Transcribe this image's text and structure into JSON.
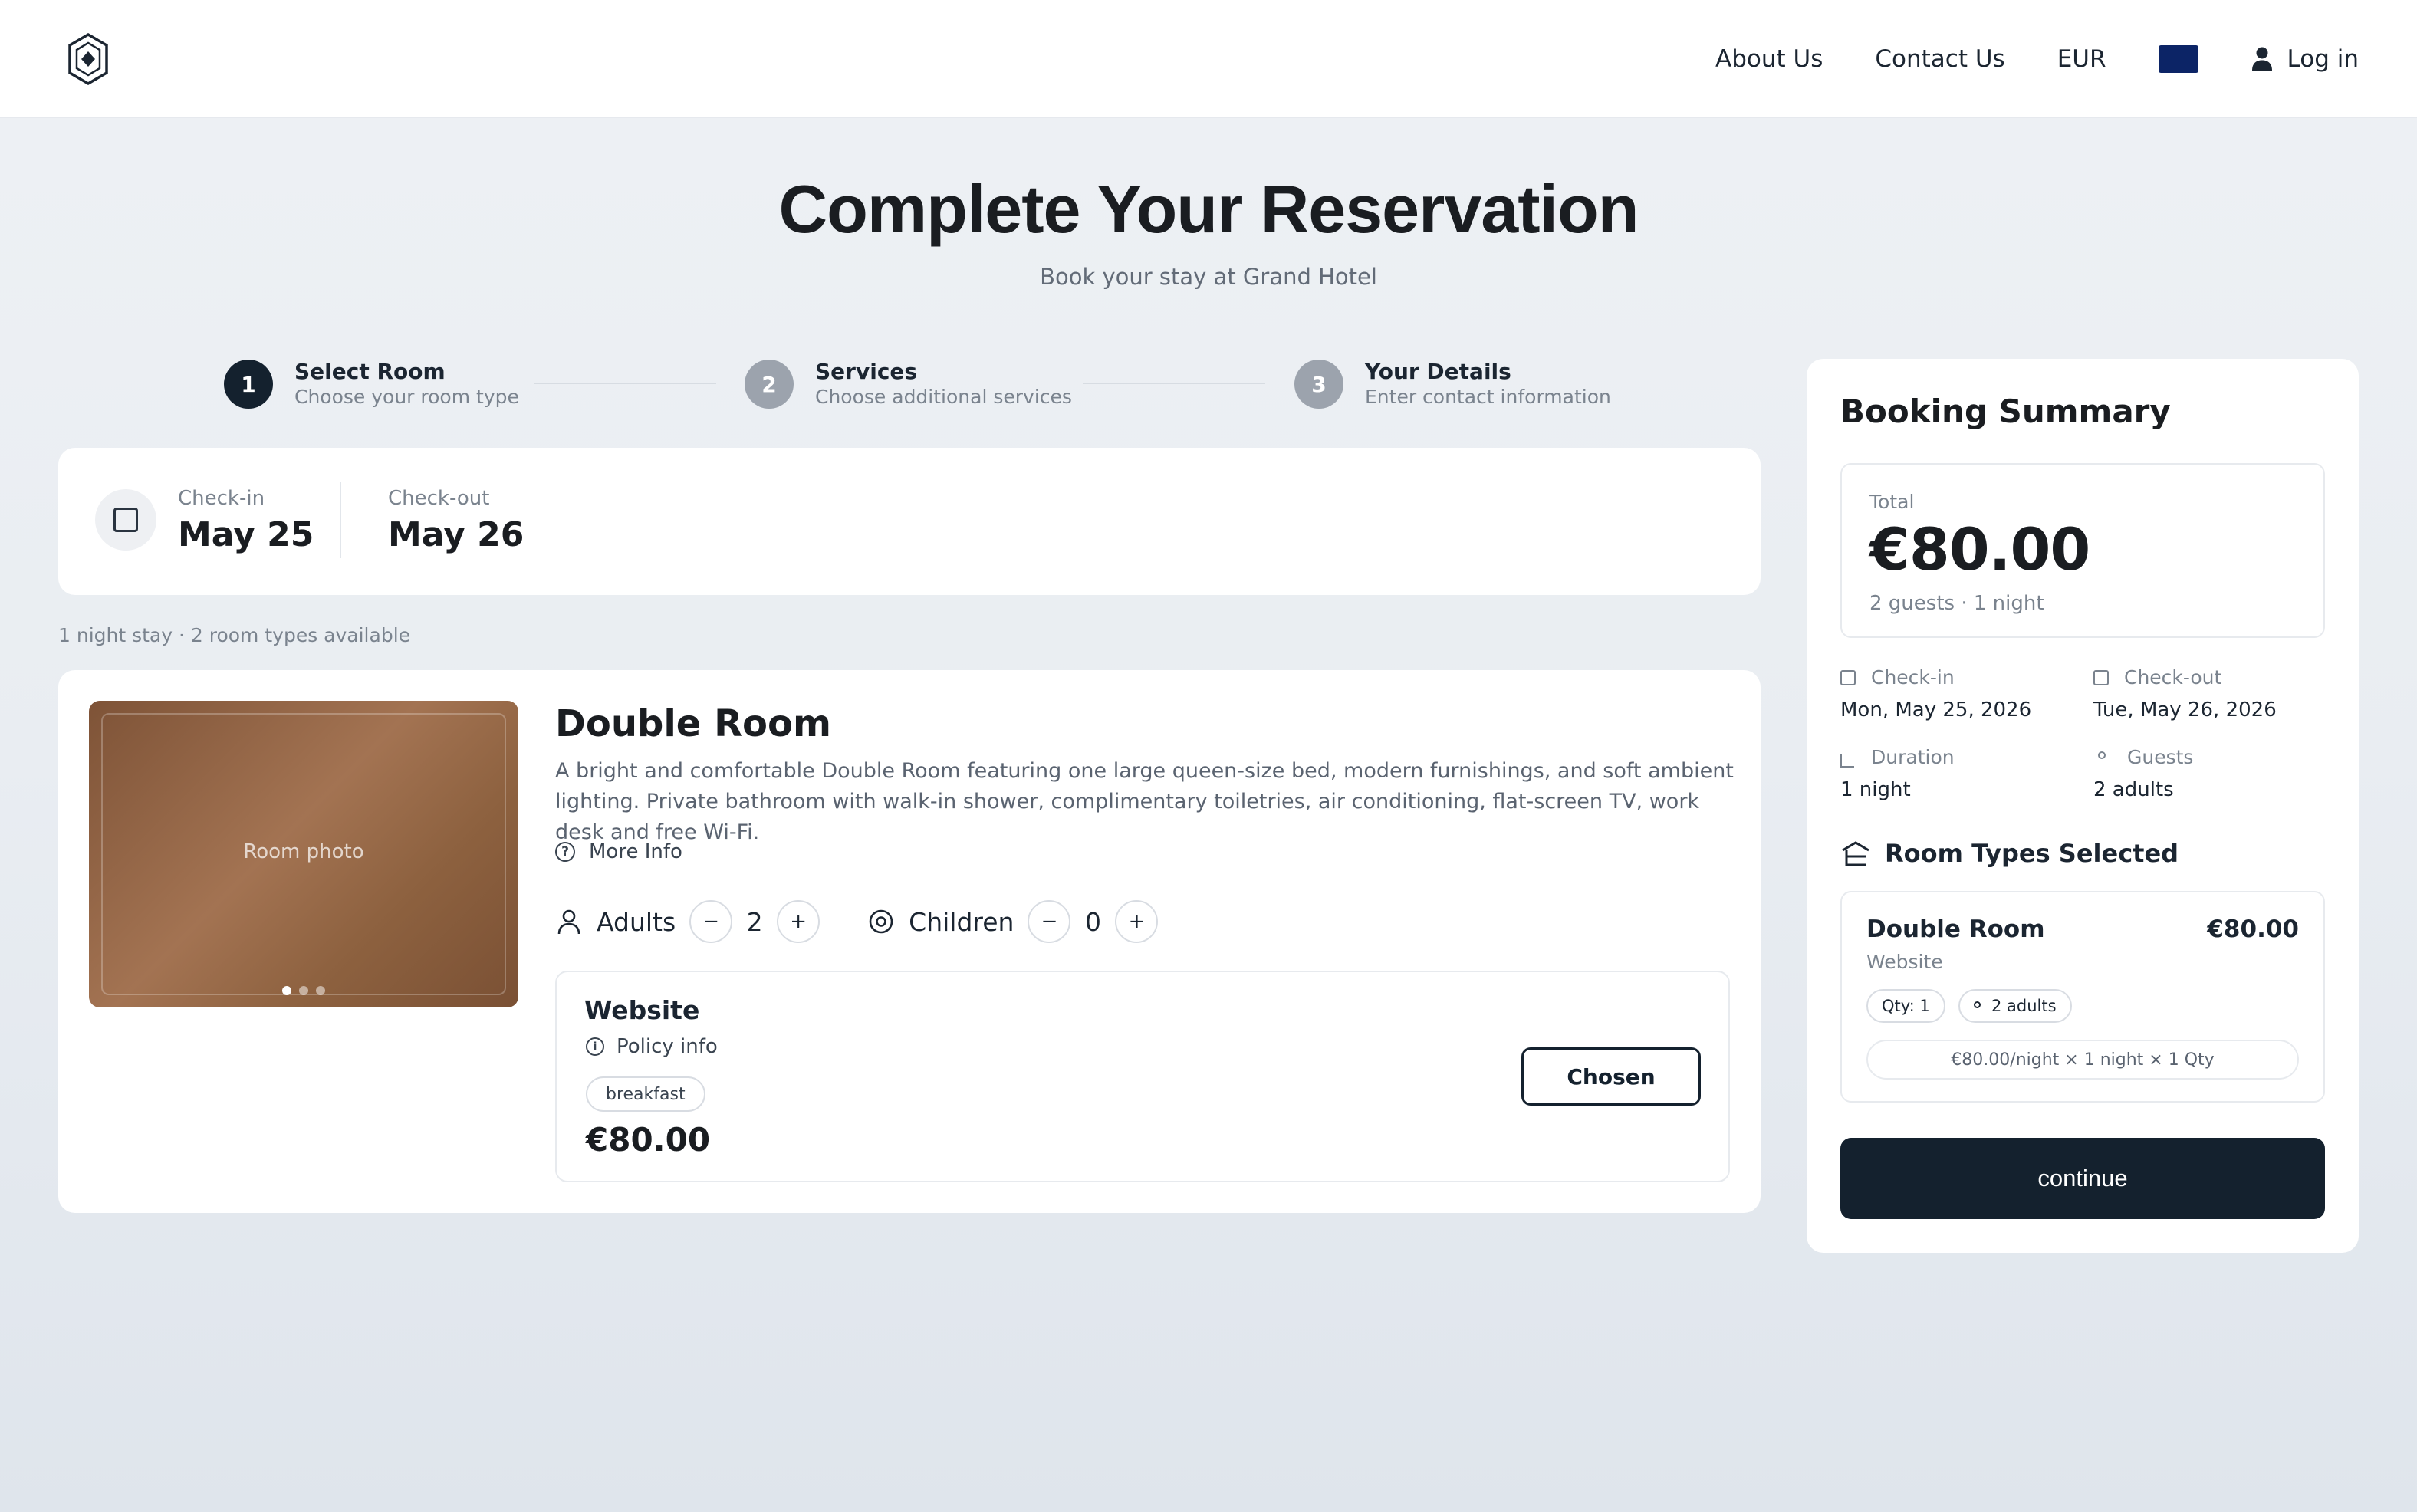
{
  "header": {
    "nav": {
      "about": "About Us",
      "contact": "Contact Us",
      "currency": "EUR",
      "login": "Log in"
    },
    "flag_color": "#0c2466"
  },
  "page": {
    "title": "Complete Your Reservation",
    "subtitle": "Book your stay at Grand Hotel"
  },
  "steps": [
    {
      "number": "1",
      "title": "Select Room",
      "subtitle": "Choose your room type",
      "active": true
    },
    {
      "number": "2",
      "title": "Services",
      "subtitle": "Choose additional services",
      "active": false
    },
    {
      "number": "3",
      "title": "Your Details",
      "subtitle": "Enter contact information",
      "active": false
    }
  ],
  "dates": {
    "checkin_label": "Check-in",
    "checkin_value": "May 25",
    "checkout_label": "Check-out",
    "checkout_value": "May 26",
    "icon": "calendar-icon"
  },
  "stay_info": "1 night stay · 2 room types available",
  "room": {
    "name": "Double Room",
    "photo_label": "Room photo",
    "photo_dots": 3,
    "description": "A bright and comfortable Double Room featuring one large queen-size bed, modern furnishings, and soft ambient lighting. Private bathroom with walk-in shower, complimentary toiletries, air conditioning, flat-screen TV, work desk and free Wi-Fi.",
    "more_info": "More Info",
    "adults_label": "Adults",
    "adults_value": "2",
    "children_label": "Children",
    "children_value": "0",
    "minus": "−",
    "plus": "+",
    "rate": {
      "name": "Website",
      "policy": "Policy info",
      "tag": "breakfast",
      "price": "€80.00",
      "button": "Chosen"
    }
  },
  "summary": {
    "title": "Booking Summary",
    "total_label": "Total",
    "total_value": "€80.00",
    "total_sub": "2 guests · 1 night",
    "checkin_label": "Check-in",
    "checkin_value": "Mon, May 25, 2026",
    "checkout_label": "Check-out",
    "checkout_value": "Tue, May 26, 2026",
    "duration_label": "Duration",
    "duration_value": "1 night",
    "guests_label": "Guests",
    "guests_value": "2 adults",
    "room_types_title": "Room Types Selected",
    "selected": {
      "name": "Double Room",
      "price": "€80.00",
      "source": "Website",
      "qty": "Qty: 1",
      "guests": "2 adults",
      "calc": "€80.00/night × 1 night × 1 Qty"
    },
    "continue": "continue"
  },
  "colors": {
    "primary_dark": "#14212e",
    "muted": "#7a838e",
    "photo_brown": "#a37352"
  }
}
